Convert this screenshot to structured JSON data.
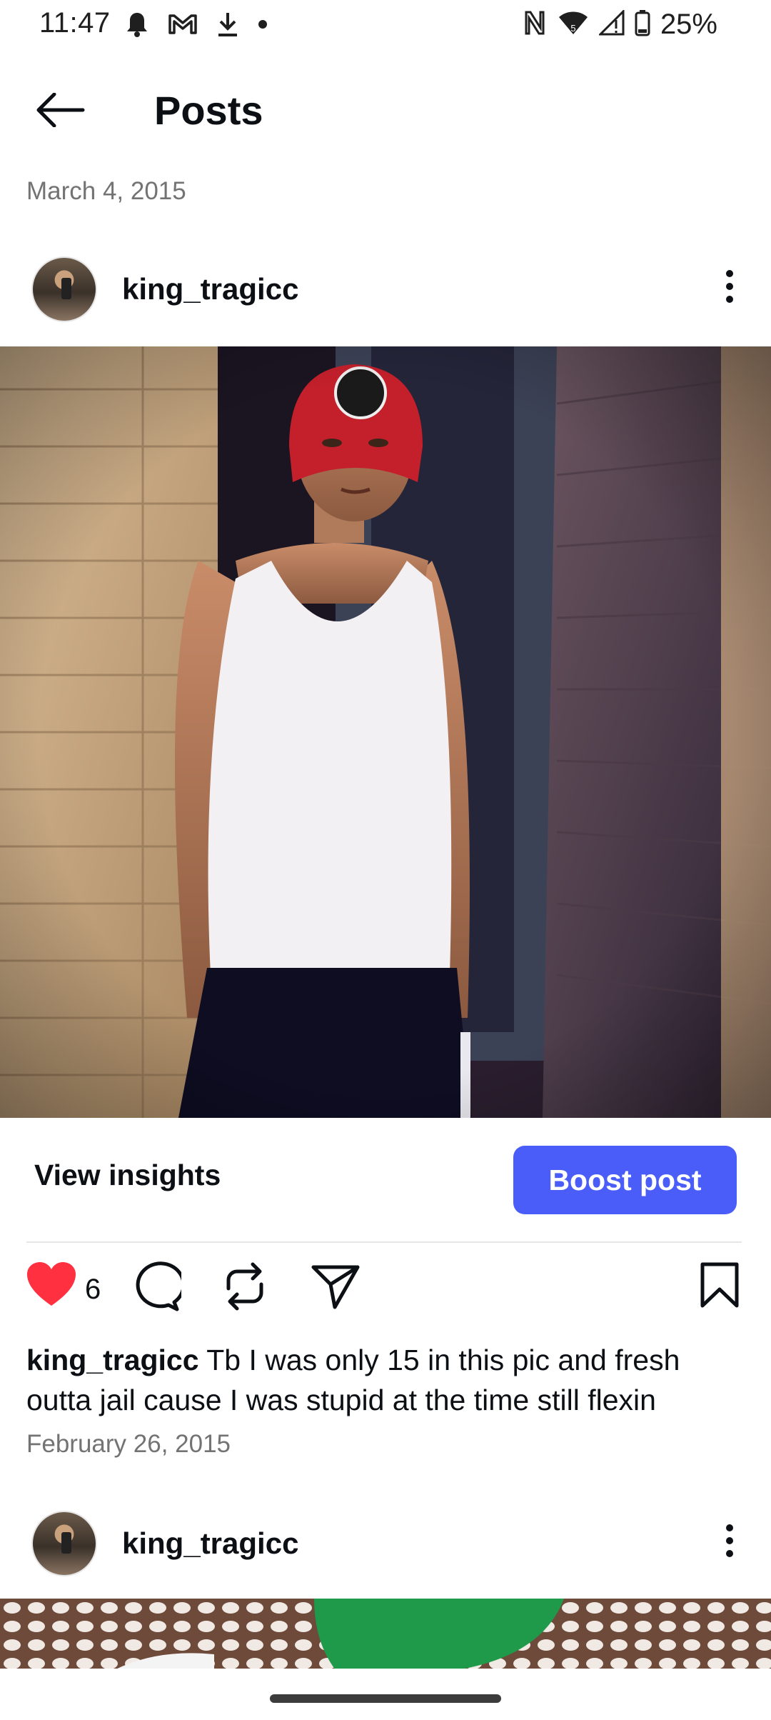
{
  "status_bar": {
    "time": "11:47",
    "battery": "25%",
    "icons": [
      "bell-icon",
      "gmail-icon",
      "download-icon",
      "dot-icon",
      "nfc-icon",
      "wifi-icon",
      "signal-icon",
      "battery-icon"
    ]
  },
  "header": {
    "title": "Posts",
    "back_icon": "arrow-left-icon"
  },
  "feed": {
    "date_top": "March 4, 2015",
    "post": {
      "username": "king_tragicc",
      "image_alt": "photo",
      "view_insights": "View insights",
      "boost_post": "Boost post",
      "like_count": "6",
      "caption_user": "king_tragicc",
      "caption_text": "Tb I was only 15 in this pic and fresh outta jail cause I was stupid at the time still flexin",
      "date": "February 26, 2015"
    },
    "next_post": {
      "username": "king_tragicc"
    }
  },
  "colors": {
    "accent": "#4a5df9",
    "like": "#ff3040",
    "muted_text": "#737373"
  }
}
